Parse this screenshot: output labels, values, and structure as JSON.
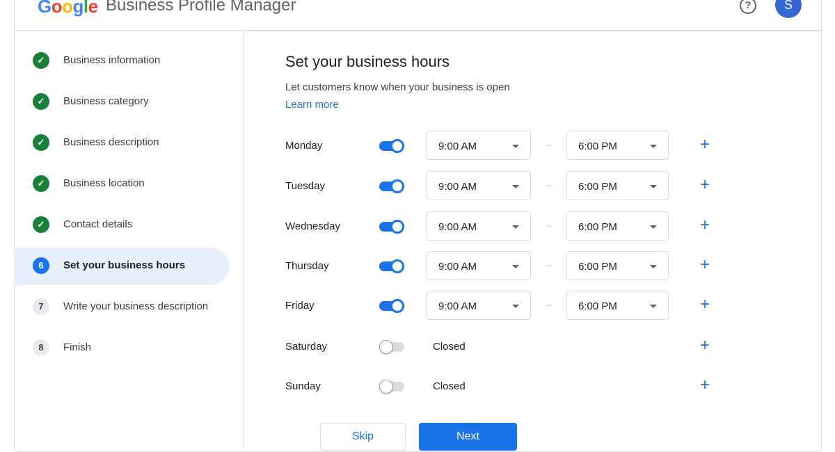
{
  "header": {
    "logo_letters": [
      {
        "ch": "G",
        "color": "#4285F4"
      },
      {
        "ch": "o",
        "color": "#EA4335"
      },
      {
        "ch": "o",
        "color": "#FBBC05"
      },
      {
        "ch": "g",
        "color": "#4285F4"
      },
      {
        "ch": "l",
        "color": "#34A853"
      },
      {
        "ch": "e",
        "color": "#EA4335"
      }
    ],
    "product_name": "Business Profile Manager",
    "help_icon_glyph": "?",
    "avatar_initial": "S"
  },
  "sidebar": {
    "steps": [
      {
        "label": "Business information",
        "state": "done",
        "marker": "✓"
      },
      {
        "label": "Business category",
        "state": "done",
        "marker": "✓"
      },
      {
        "label": "Business description",
        "state": "done",
        "marker": "✓"
      },
      {
        "label": "Business location",
        "state": "done",
        "marker": "✓"
      },
      {
        "label": "Contact details",
        "state": "done",
        "marker": "✓"
      },
      {
        "label": "Set your business hours",
        "state": "current",
        "marker": "6"
      },
      {
        "label": "Write your business description",
        "state": "todo",
        "marker": "7"
      },
      {
        "label": "Finish",
        "state": "todo",
        "marker": "8"
      }
    ]
  },
  "main": {
    "title": "Set your business hours",
    "subtitle": "Let customers know when your business is open",
    "learn_more": "Learn more",
    "dash": "–",
    "add_glyph": "+",
    "days": [
      {
        "name": "Monday",
        "open": true,
        "open_time": "9:00 AM",
        "close_time": "6:00 PM",
        "closed_label": ""
      },
      {
        "name": "Tuesday",
        "open": true,
        "open_time": "9:00 AM",
        "close_time": "6:00 PM",
        "closed_label": ""
      },
      {
        "name": "Wednesday",
        "open": true,
        "open_time": "9:00 AM",
        "close_time": "6:00 PM",
        "closed_label": ""
      },
      {
        "name": "Thursday",
        "open": true,
        "open_time": "9:00 AM",
        "close_time": "6:00 PM",
        "closed_label": ""
      },
      {
        "name": "Friday",
        "open": true,
        "open_time": "9:00 AM",
        "close_time": "6:00 PM",
        "closed_label": ""
      },
      {
        "name": "Saturday",
        "open": false,
        "open_time": "",
        "close_time": "",
        "closed_label": "Closed"
      },
      {
        "name": "Sunday",
        "open": false,
        "open_time": "",
        "close_time": "",
        "closed_label": "Closed"
      }
    ],
    "buttons": {
      "skip": "Skip",
      "next": "Next"
    }
  },
  "colors": {
    "accent": "#1a73e8",
    "done": "#188038",
    "active_bg": "#e8f0fe"
  }
}
